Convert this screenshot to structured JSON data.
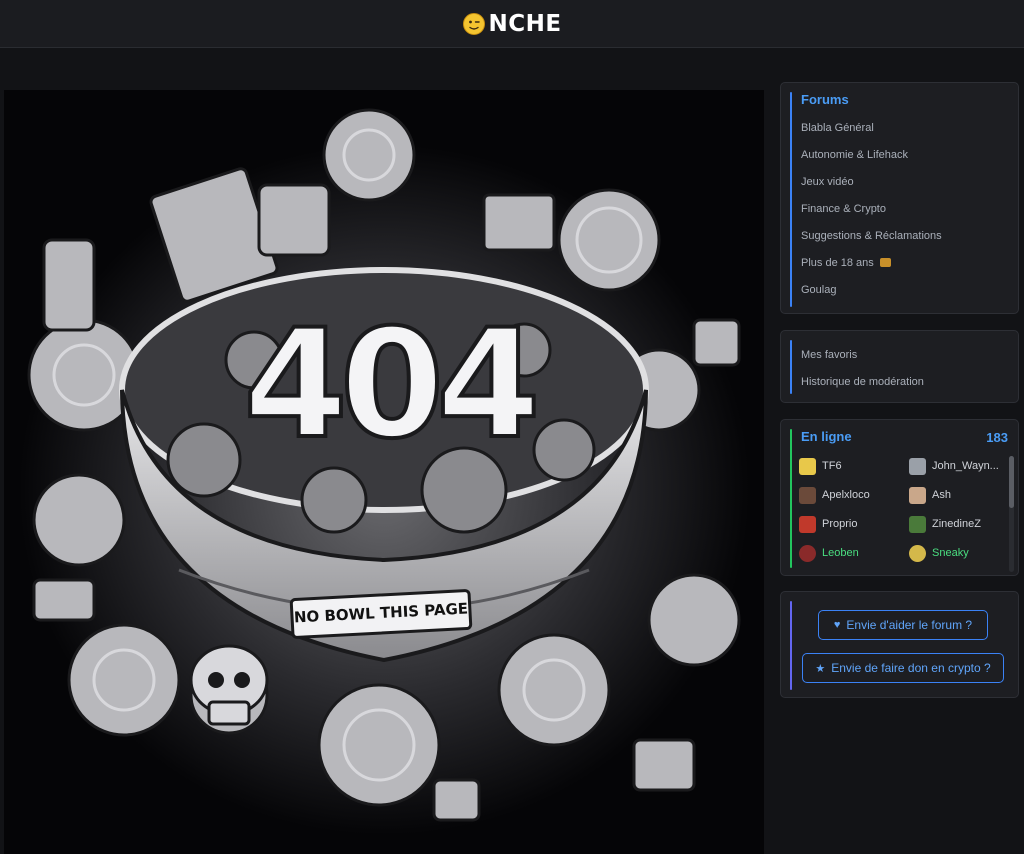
{
  "header": {
    "logo_text": "NCHE",
    "logo_icon": "smiley-face-icon"
  },
  "hero": {
    "number": "404",
    "banner": "NO BOWL THIS PAGE",
    "alt_icon": "404-bowl-illustration"
  },
  "forums": {
    "title": "Forums",
    "items": [
      {
        "label": "Blabla Général"
      },
      {
        "label": "Autonomie & Lifehack"
      },
      {
        "label": "Jeux vidéo"
      },
      {
        "label": "Finance & Crypto"
      },
      {
        "label": "Suggestions & Réclamations"
      },
      {
        "label": "Plus de 18 ans",
        "icon": "sticker-icon"
      },
      {
        "label": "Goulag"
      }
    ]
  },
  "links": {
    "items": [
      {
        "label": "Mes favoris"
      },
      {
        "label": "Historique de modération"
      }
    ]
  },
  "online": {
    "title": "En ligne",
    "count": "183",
    "users": [
      {
        "name": "TF6",
        "avatar": "#e8c84a"
      },
      {
        "name": "John_Wayn...",
        "avatar": "#9aa0a8"
      },
      {
        "name": "Apelxloco",
        "avatar": "#6b4a3a"
      },
      {
        "name": "Ash",
        "avatar": "#c9a78a"
      },
      {
        "name": "Proprio",
        "avatar": "#c0392b"
      },
      {
        "name": "ZinedineZ",
        "avatar": "#4a7a3a"
      },
      {
        "name": "Leoben",
        "avatar": "#8a2a2a",
        "status": "green"
      },
      {
        "name": "Sneaky",
        "avatar": "#d4b84a",
        "status": "green"
      }
    ]
  },
  "donate": {
    "help_label": "Envie d'aider le forum ?",
    "help_icon": "heart-icon",
    "crypto_label": "Envie de faire don en crypto ?",
    "crypto_icon": "star-icon"
  },
  "colors": {
    "accent": "#3b82f6",
    "online": "#22c55e",
    "bg": "#121316",
    "panel": "#1d1e22"
  }
}
